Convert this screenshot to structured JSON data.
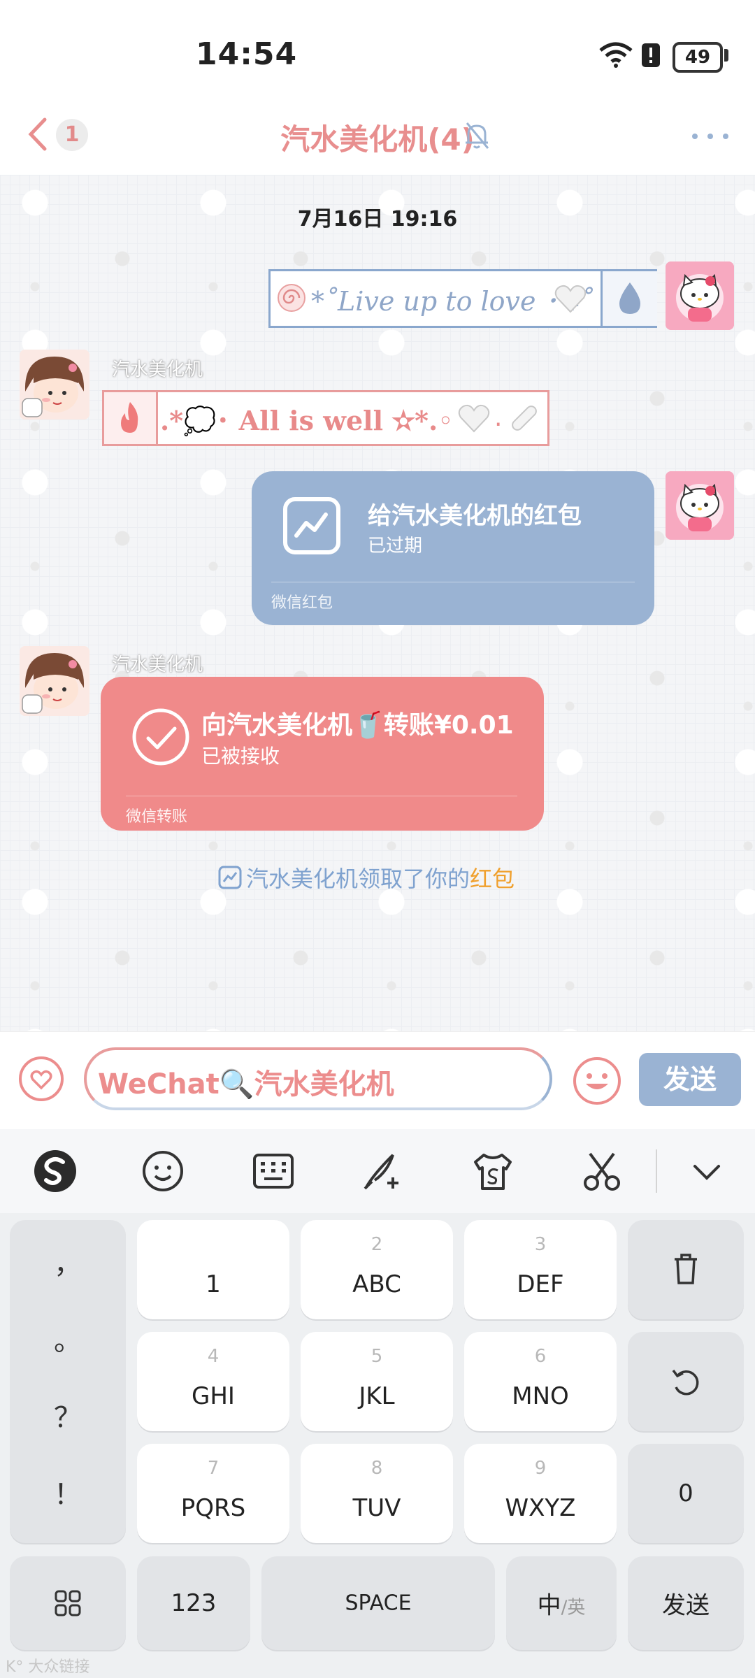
{
  "status_bar": {
    "time": "14:54",
    "battery": "49"
  },
  "header": {
    "back_count": "1",
    "title": "汽水美化机(4)"
  },
  "chat": {
    "time_divider": "7月16日 19:16",
    "msg1": {
      "text": "*˚Live up to love ･ ₊˚"
    },
    "sender_name_1": "汽水美化机",
    "msg2": {
      "text": ".*💭･ All is well ✫*.◦"
    },
    "red_packet": {
      "title": "给汽水美化机的红包",
      "status": "已过期",
      "footer": "微信红包"
    },
    "sender_name_2": "汽水美化机",
    "transfer": {
      "title": "向汽水美化机🥤转账¥0.01",
      "status": "已被接收",
      "footer": "微信转账"
    },
    "system_msg": {
      "prefix": "汽水美化机领取了你的",
      "highlight": "红包"
    }
  },
  "input_bar": {
    "text": "WeChat🔍汽水美化机",
    "send_label": "发送"
  },
  "keyboard": {
    "toolbar_icons": [
      "sogou-logo-icon",
      "emoji-icon",
      "keyboard-icon",
      "handwriting-icon",
      "skin-icon",
      "scissors-icon",
      "collapse-icon"
    ],
    "punct": [
      "，",
      "。",
      "？",
      "！"
    ],
    "keys": [
      {
        "num": "",
        "label": "1"
      },
      {
        "num": "2",
        "label": "ABC"
      },
      {
        "num": "3",
        "label": "DEF"
      },
      {
        "num": "4",
        "label": "GHI"
      },
      {
        "num": "5",
        "label": "JKL"
      },
      {
        "num": "6",
        "label": "MNO"
      },
      {
        "num": "7",
        "label": "PQRS"
      },
      {
        "num": "8",
        "label": "TUV"
      },
      {
        "num": "9",
        "label": "WXYZ"
      }
    ],
    "zero": "0",
    "bottom": {
      "num_key": "123",
      "space": "SPACE",
      "lang_main": "中",
      "lang_alt": "/英",
      "send": "发送"
    }
  },
  "watermark": "K° 大众链接",
  "colors": {
    "pink": "#ec8d8d",
    "blue": "#9ab3d3",
    "orange": "#f0a02d"
  }
}
